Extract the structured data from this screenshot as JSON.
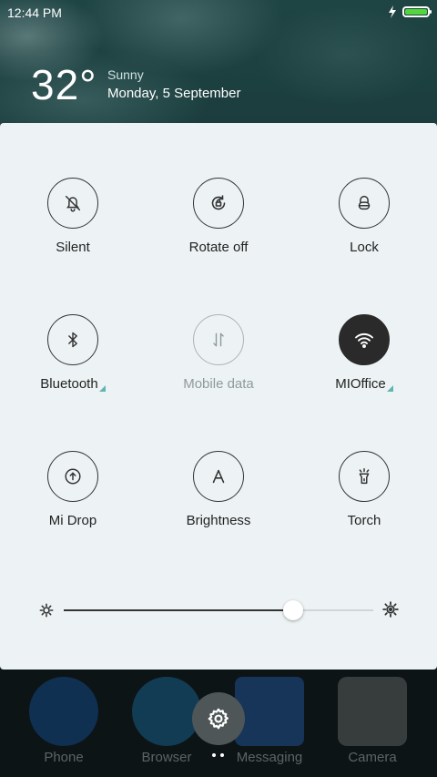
{
  "status_bar": {
    "time": "12:44 PM"
  },
  "weather": {
    "temperature": "32°",
    "condition": "Sunny",
    "date": "Monday, 5 September"
  },
  "toggles": [
    {
      "label": "Silent",
      "icon": "bell-off-icon",
      "state": "off"
    },
    {
      "label": "Rotate off",
      "icon": "rotate-lock-icon",
      "state": "off"
    },
    {
      "label": "Lock",
      "icon": "lock-icon",
      "state": "off"
    },
    {
      "label": "Bluetooth",
      "icon": "bluetooth-icon",
      "state": "off",
      "expandable": true
    },
    {
      "label": "Mobile data",
      "icon": "mobile-data-icon",
      "state": "disabled"
    },
    {
      "label": "MIOffice",
      "icon": "wifi-icon",
      "state": "on",
      "expandable": true
    },
    {
      "label": "Mi Drop",
      "icon": "mi-drop-icon",
      "state": "off"
    },
    {
      "label": "Brightness",
      "icon": "auto-brightness-icon",
      "state": "off"
    },
    {
      "label": "Torch",
      "icon": "torch-icon",
      "state": "off"
    }
  ],
  "brightness": {
    "level": 0.74
  },
  "dock": {
    "apps": [
      {
        "label": "Phone",
        "color": "#1565c0"
      },
      {
        "label": "Browser",
        "color": "#1e88c8"
      },
      {
        "label": "Messaging",
        "color": "#2b6fd6"
      },
      {
        "label": "Camera",
        "color": "#888888"
      }
    ]
  },
  "colors": {
    "panel_bg": "#edf3f4",
    "active_toggle": "#2a2a2a",
    "expand_indicator": "#5fb5b0",
    "battery": "#52d63b"
  }
}
